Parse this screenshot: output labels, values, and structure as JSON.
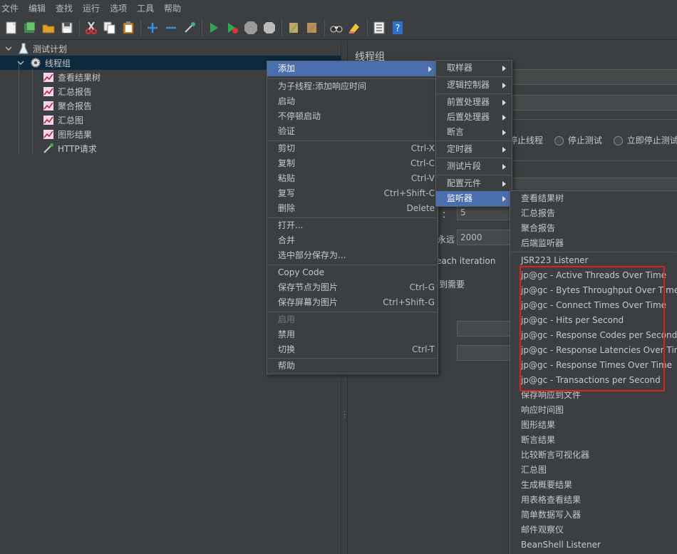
{
  "menubar": [
    "文件",
    "编辑",
    "查找",
    "运行",
    "选项",
    "工具",
    "帮助"
  ],
  "toolbar": [
    "new-icon",
    "templates-icon",
    "open-icon",
    "save-icon",
    "cut-icon",
    "copy-icon",
    "paste-icon",
    "expand-icon",
    "collapse-icon",
    "toggle-icon",
    "start-icon",
    "start-no-pause-icon",
    "stop-icon",
    "shutdown-icon",
    "clear-icon",
    "clear-all-icon",
    "search-icon",
    "reset-search-icon",
    "function-helper-icon",
    "help-icon"
  ],
  "tree": {
    "plan": "测试计划",
    "thread_group": "线程组",
    "children": [
      "查看结果树",
      "汇总报告",
      "聚合报告",
      "汇总图",
      "图形结果",
      "HTTP请求"
    ]
  },
  "right_panel": {
    "title": "线程组",
    "stop_thread": "停止线程",
    "stop_test": "停止测试",
    "stop_test_now": "立即停止测试",
    "threads_label": "：",
    "threads_value": "5",
    "forever_label": "永远",
    "loop_value": "2000",
    "each_iteration": "each iteration",
    "delay_label": "到需要"
  },
  "context_menu": {
    "add": "添加",
    "items1": [
      "为子线程:添加响应时间",
      "启动",
      "不停顿启动",
      "验证"
    ],
    "items2": [
      {
        "label": "剪切",
        "shortcut": "Ctrl-X"
      },
      {
        "label": "复制",
        "shortcut": "Ctrl-C"
      },
      {
        "label": "粘贴",
        "shortcut": "Ctrl-V"
      },
      {
        "label": "复写",
        "shortcut": "Ctrl+Shift-C"
      },
      {
        "label": "删除",
        "shortcut": "Delete"
      }
    ],
    "items3": [
      "打开...",
      "合并",
      "选中部分保存为..."
    ],
    "items4": [
      {
        "label": "Copy Code",
        "shortcut": ""
      },
      {
        "label": "保存节点为图片",
        "shortcut": "Ctrl-G"
      },
      {
        "label": "保存屏幕为图片",
        "shortcut": "Ctrl+Shift-G"
      }
    ],
    "enable": "启用",
    "disable": "禁用",
    "toggle": {
      "label": "切换",
      "shortcut": "Ctrl-T"
    },
    "help": "帮助"
  },
  "add_submenu": [
    "取样器",
    "逻辑控制器",
    "前置处理器",
    "后置处理器",
    "断言",
    "定时器",
    "测试片段",
    "配置元件",
    "监听器"
  ],
  "listener_submenu": {
    "group1": [
      "查看结果树",
      "汇总报告",
      "聚合报告",
      "后端监听器"
    ],
    "group2": [
      "JSR223 Listener",
      "jp@gc - Active Threads Over Time",
      "jp@gc - Bytes Throughput Over Time",
      "jp@gc - Connect Times Over Time",
      "jp@gc - Hits per Second",
      "jp@gc - Response Codes per Second",
      "jp@gc - Response Latencies Over Time",
      "jp@gc - Response Times Over Time",
      "jp@gc - Transactions per Second",
      "保存响应到文件",
      "响应时间图",
      "图形结果",
      "断言结果",
      "比较断言可视化器",
      "汇总图",
      "生成概要结果",
      "用表格查看结果",
      "简单数据写入器",
      "邮件观察仪",
      "BeanShell Listener"
    ]
  },
  "colors": {
    "highlight": "#4b6eaf",
    "annotation_box": "#e0201b",
    "background": "#3c3f41"
  }
}
